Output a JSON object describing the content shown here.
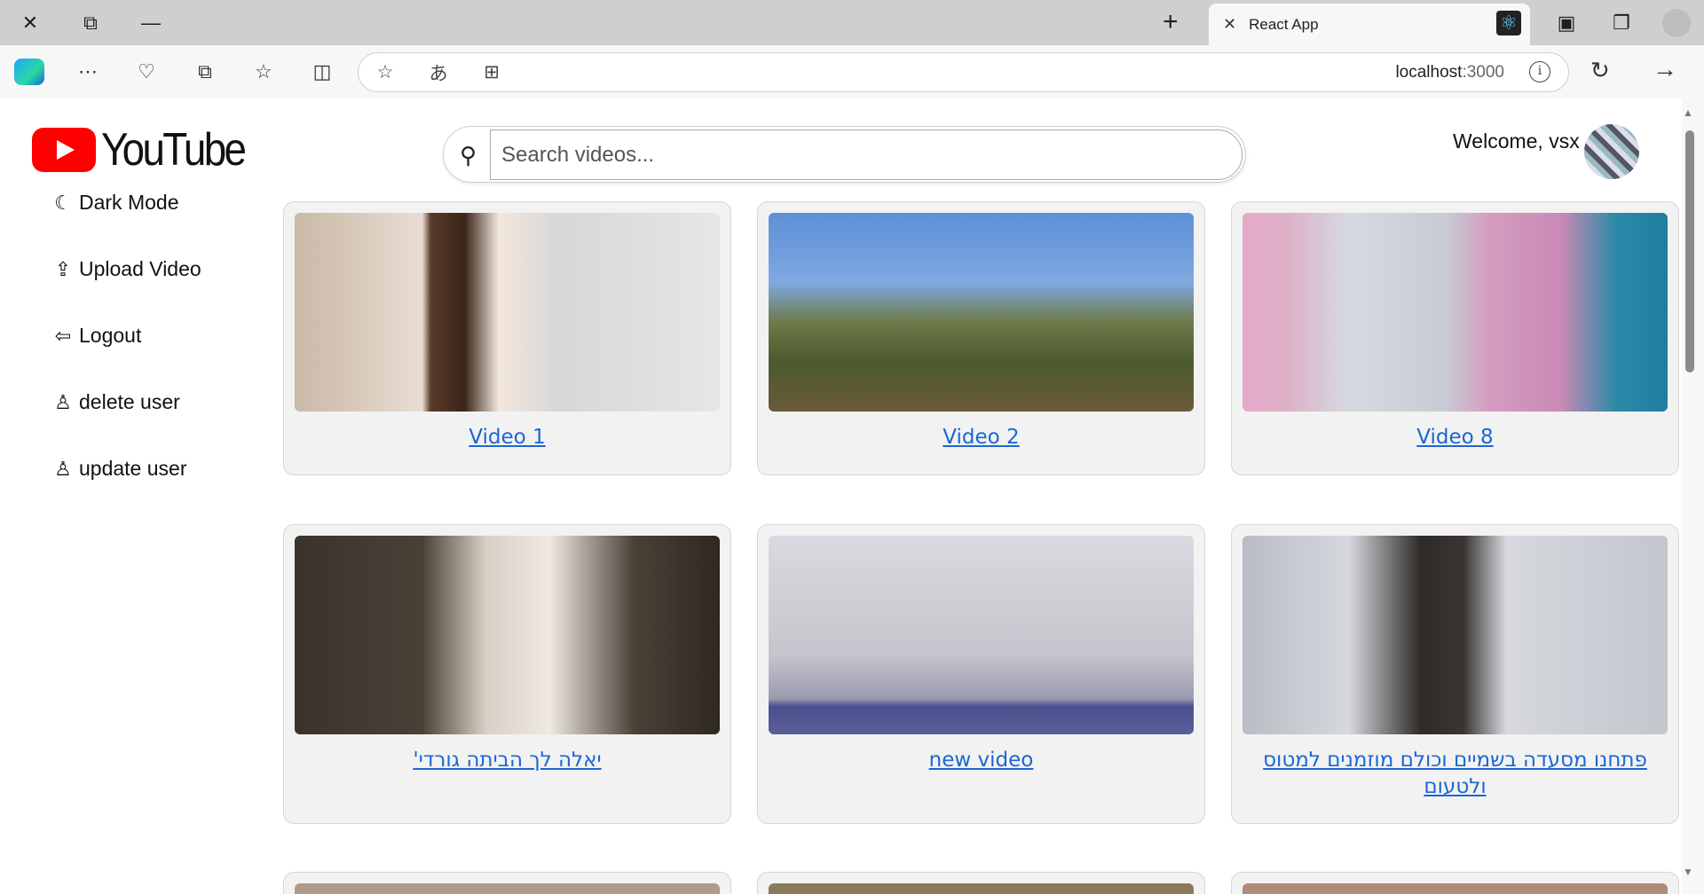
{
  "browser": {
    "tab_title": "React App",
    "url_host": "localhost",
    "url_port": ":3000",
    "icons": [
      "close-icon",
      "restore-icon",
      "minimize-icon",
      "new-tab-icon",
      "workspaces-icon",
      "collections-icon",
      "profile-icon",
      "copilot-icon",
      "more-icon",
      "health-icon",
      "tab-actions-icon",
      "favorites-icon",
      "split-screen-icon",
      "star-icon",
      "read-aloud-icon",
      "apps-icon",
      "info-icon",
      "refresh-icon",
      "forward-icon"
    ]
  },
  "header": {
    "logo_text": "YouTube",
    "search_placeholder": "Search videos...",
    "welcome_text": "Welcome, vsx"
  },
  "sidebar": {
    "items": [
      {
        "label": "Dark Mode",
        "icon": "dark-mode-icon"
      },
      {
        "label": "Upload Video",
        "icon": "upload-icon"
      },
      {
        "label": "Logout",
        "icon": "logout-icon"
      },
      {
        "label": "delete user",
        "icon": "delete-user-icon"
      },
      {
        "label": "update user",
        "icon": "update-user-icon"
      }
    ]
  },
  "videos": [
    {
      "title": "Video 1"
    },
    {
      "title": "Video 2"
    },
    {
      "title": "Video 8"
    },
    {
      "title": "יאלה לך הביתה גורדי'"
    },
    {
      "title": "new video"
    },
    {
      "title": "פתחנו מסעדה בשמיים וכולם מוזמנים למטוס ולטעום"
    }
  ],
  "colors": {
    "link": "#1a66d6",
    "card_bg": "#f2f2f2",
    "brand_red": "#ff0000"
  }
}
